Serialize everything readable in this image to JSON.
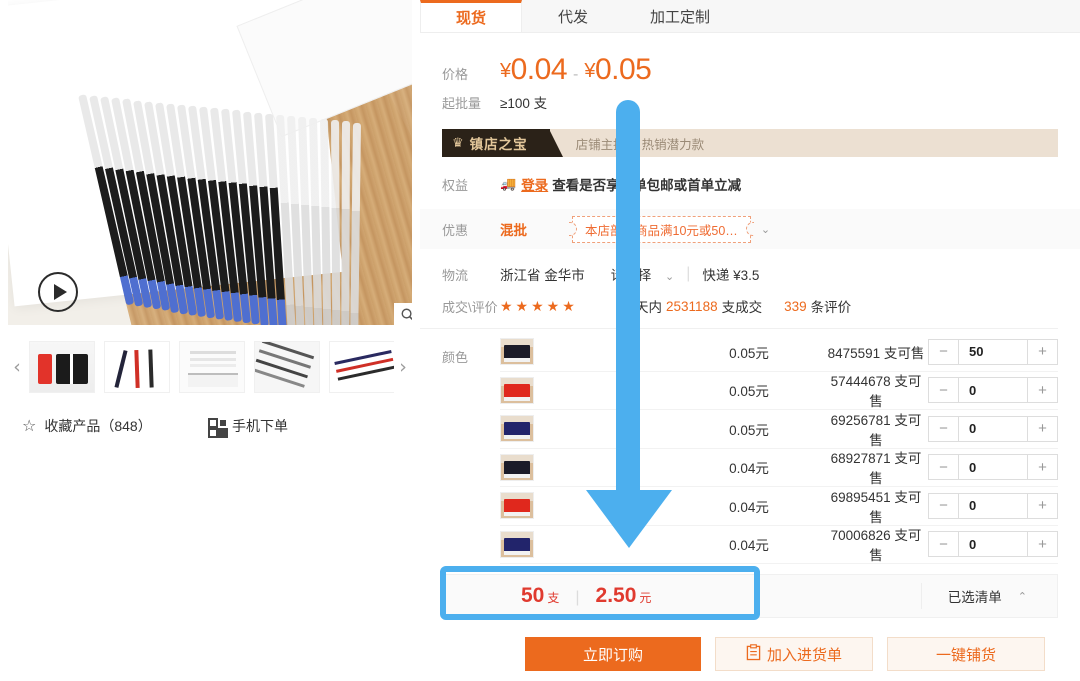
{
  "gallery": {
    "play_icon": "play-icon",
    "zoom_icon": "magnifier-icon",
    "prev_arrow": "‹",
    "next_arrow": "›",
    "thumbnails": [
      "thumb-pen-cups",
      "thumb-pens-trio",
      "thumb-packaging",
      "thumb-pens-black",
      "thumb-pens-colors"
    ],
    "favorite": {
      "icon": "star-outline-icon",
      "label": "收藏产品（848）"
    },
    "mobile_order": {
      "icon": "qrcode-icon",
      "label": "手机下单"
    }
  },
  "tabs": [
    {
      "label": "现货",
      "active": true
    },
    {
      "label": "代发",
      "active": false
    },
    {
      "label": "加工定制",
      "active": false
    }
  ],
  "price": {
    "label": "价格",
    "currency": "¥",
    "min": "0.04",
    "max": "0.05",
    "dash": "-"
  },
  "moq": {
    "label": "起批量",
    "value": "≥100 支"
  },
  "banner": {
    "icon": "crown-icon",
    "badge": "镇店之宝",
    "text": "店铺主推品  热销潜力款"
  },
  "benefit": {
    "label": "权益",
    "icon": "truck-icon",
    "link": "登录",
    "text": "查看是否享首单包邮或首单立减"
  },
  "promo": {
    "label": "优惠",
    "tag": "混批",
    "coupon": "本店部分商品满10元或50…",
    "caret": "⌄"
  },
  "logistics": {
    "label": "物流",
    "location": "浙江省 金华市",
    "select": "请选择",
    "select_caret": "⌄",
    "divider": "|",
    "shipping": "快递 ¥3.5"
  },
  "deal": {
    "label": "成交\\评价",
    "stars": "★★★★★",
    "period": "30天内",
    "count": "2531188",
    "count_suffix": "支成交",
    "reviews": "339",
    "reviews_suffix": "条评价"
  },
  "sku": {
    "label": "颜色",
    "minus": "−",
    "plus": "+",
    "rows": [
      {
        "swatch": "black",
        "color": "#1b1b28",
        "price": "0.05元",
        "stock": "8475591 支可售",
        "qty": "50"
      },
      {
        "swatch": "red",
        "color": "#e0281d",
        "price": "0.05元",
        "stock": "57444678 支可售",
        "qty": "0"
      },
      {
        "swatch": "blue",
        "color": "#22246b",
        "price": "0.05元",
        "stock": "69256781 支可售",
        "qty": "0"
      },
      {
        "swatch": "black",
        "color": "#1b1b28",
        "price": "0.04元",
        "stock": "68927871 支可售",
        "qty": "0"
      },
      {
        "swatch": "red",
        "color": "#e0281d",
        "price": "0.04元",
        "stock": "69895451 支可售",
        "qty": "0"
      },
      {
        "swatch": "blue",
        "color": "#22246b",
        "price": "0.04元",
        "stock": "70006826 支可售",
        "qty": "0"
      }
    ]
  },
  "total": {
    "qty": "50",
    "qty_unit": "支",
    "separator": "|",
    "amount": "2.50",
    "amount_unit": "元",
    "selected_list": "已选清单",
    "selected_caret": "⌃"
  },
  "actions": {
    "order_now": "立即订购",
    "add_to_cart_icon": "clipboard-icon",
    "add_to_cart": "加入进货单",
    "one_click": "一键铺货"
  },
  "annotation": {
    "arrow_color": "#4cafee",
    "highlight_color": "#4cafee",
    "points_to": "total-bar"
  }
}
